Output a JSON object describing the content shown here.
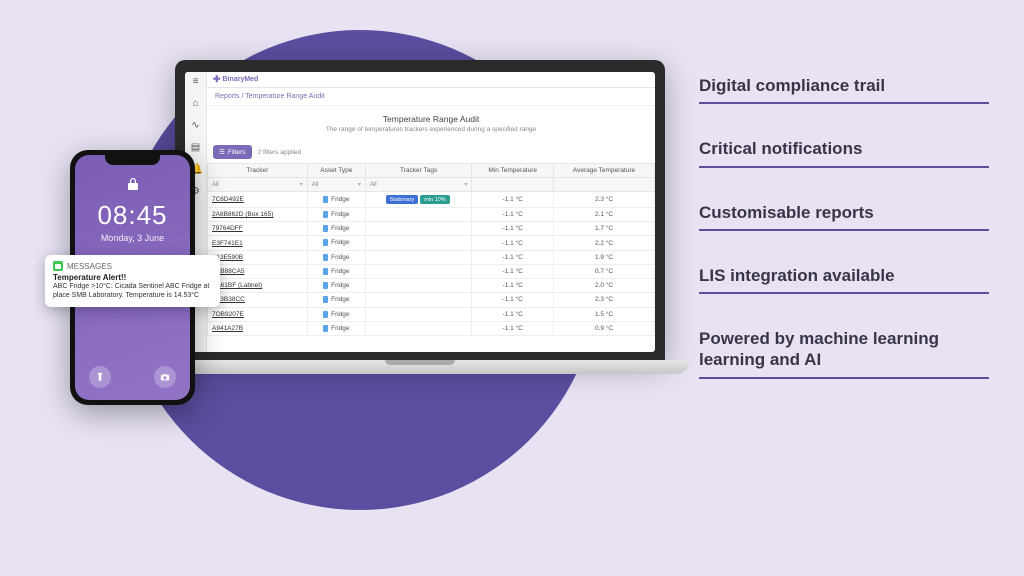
{
  "app": {
    "logo_text": "BinaryMed",
    "breadcrumb": "Reports / Temperature Range Audit",
    "report_title": "Temperature Range Audit",
    "report_subtitle": "The range of temperatures trackers experienced during a specified range",
    "filters_label": "Filters",
    "filters_applied": "2 filters applied",
    "columns": {
      "tracker": "Tracker",
      "asset_type": "Asset Type",
      "tracker_tags": "Tracker Tags",
      "min_temp": "Min Temperature",
      "avg_temp": "Average Temperature"
    },
    "filter_all": "All",
    "rows": [
      {
        "tracker": "7C6D492E",
        "asset": "Fridge",
        "tags": [
          "Stationary",
          "min 10%"
        ],
        "min": "-1.1 °C",
        "avg": "2.3 °C"
      },
      {
        "tracker": "2A8B862D (Box 165)",
        "asset": "Fridge",
        "tags": [],
        "min": "-1.1 °C",
        "avg": "2.1 °C"
      },
      {
        "tracker": "79764DFF",
        "asset": "Fridge",
        "tags": [],
        "min": "-1.1 °C",
        "avg": "1.7 °C"
      },
      {
        "tracker": "E3F741E1",
        "asset": "Fridge",
        "tags": [],
        "min": "-1.1 °C",
        "avg": "2.2 °C"
      },
      {
        "tracker": "4A3E590B",
        "asset": "Fridge",
        "tags": [],
        "min": "-1.1 °C",
        "avg": "1.9 °C"
      },
      {
        "tracker": "7CB88CA5",
        "asset": "Fridge",
        "tags": [],
        "min": "-1.1 °C",
        "avg": "0.7 °C"
      },
      {
        "tracker": "BA61BF (Labnet)",
        "asset": "Fridge",
        "tags": [],
        "min": "-1.1 °C",
        "avg": "2.0 °C"
      },
      {
        "tracker": "C23B38CC",
        "asset": "Fridge",
        "tags": [],
        "min": "-1.1 °C",
        "avg": "2.3 °C"
      },
      {
        "tracker": "7OB9207E",
        "asset": "Fridge",
        "tags": [],
        "min": "-1.1 °C",
        "avg": "1.5 °C"
      },
      {
        "tracker": "A941A27B",
        "asset": "Fridge",
        "tags": [],
        "min": "-1.1 °C",
        "avg": "0.9 °C"
      }
    ]
  },
  "phone": {
    "time": "08:45",
    "date": "Monday, 3 June",
    "notification": {
      "app": "MESSAGES",
      "title": "Temperature Alert!!",
      "body": "ABC Fridge >10°C: Cicada Sentinel ABC Fridge at place SMB Laboratory. Temperature is 14.53°C"
    }
  },
  "features": [
    "Digital compliance trail",
    "Critical notifications",
    "Customisable reports",
    "LIS integration available",
    "Powered by machine learning learning and AI"
  ]
}
